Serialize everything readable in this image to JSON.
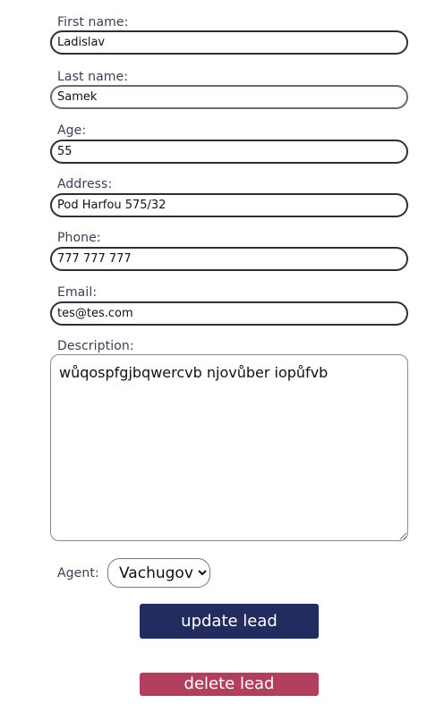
{
  "form": {
    "first_name": {
      "label": "First name:",
      "value": "Ladislav"
    },
    "last_name": {
      "label": "Last name:",
      "value": "Samek"
    },
    "age": {
      "label": "Age:",
      "value": "55"
    },
    "address": {
      "label": "Address:",
      "value": "Pod Harfou 575/32"
    },
    "phone": {
      "label": "Phone:",
      "value": "777 777 777"
    },
    "email": {
      "label": "Email:",
      "value": "tes@tes.com"
    },
    "description": {
      "label": "Description:",
      "value": "wůqospfgjbqwercvb njovůber iopůfvb"
    },
    "agent": {
      "label": "Agent:",
      "selected": "Vachugov"
    }
  },
  "buttons": {
    "update_label": "update lead",
    "delete_label": "delete lead"
  },
  "colors": {
    "update_button": "#222c5e",
    "delete_button": "#b23f5e",
    "label_text": "#3a3f55"
  }
}
